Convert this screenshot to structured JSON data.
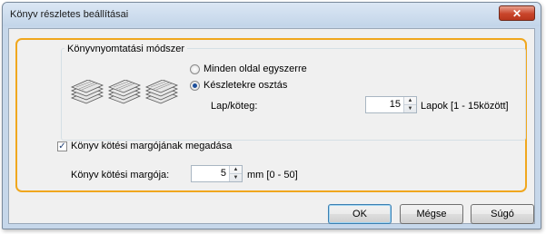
{
  "window": {
    "title": "Könyv részletes beállításai",
    "close_glyph": "✕"
  },
  "group": {
    "label": "Könyvnyomtatási módszer",
    "options": [
      {
        "label": "Minden oldal egyszerre",
        "selected": false
      },
      {
        "label": "Készletekre osztás",
        "selected": true
      }
    ],
    "sheets_label": "Lap/köteg:",
    "sheets_value": "15",
    "sheets_range": "Lapok [1 - 15között]"
  },
  "margin": {
    "checkbox_label": "Könyv kötési margójának megadása",
    "checked": true,
    "field_label": "Könyv kötési margója:",
    "field_value": "5",
    "field_range": "mm [0 - 50]"
  },
  "buttons": {
    "ok": "OK",
    "cancel": "Mégse",
    "help": "Súgó"
  },
  "colors": {
    "highlight": "#f0a71e",
    "accent": "#1d4f9b"
  },
  "icons": {
    "spin_up": "▲",
    "spin_down": "▼",
    "check": "✓"
  }
}
